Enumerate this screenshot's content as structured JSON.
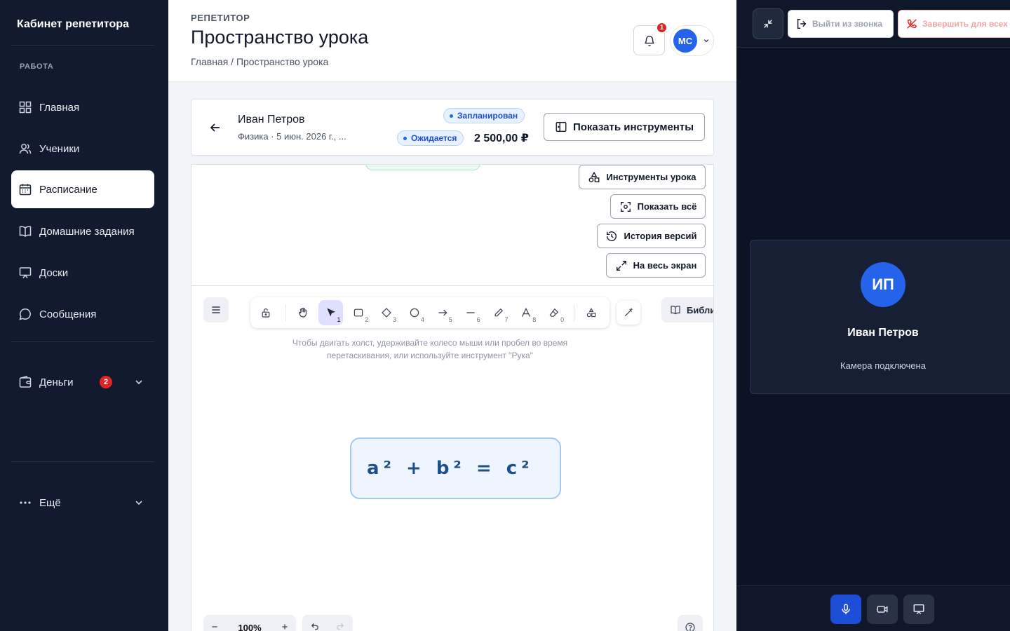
{
  "sidebar": {
    "brand": "Кабинет репетитора",
    "section": "РАБОТА",
    "items": [
      {
        "label": "Главная",
        "icon": "grid-icon"
      },
      {
        "label": "Ученики",
        "icon": "users-icon"
      },
      {
        "label": "Расписание",
        "icon": "calendar-icon",
        "active": true
      },
      {
        "label": "Домашние задания",
        "icon": "book-icon"
      },
      {
        "label": "Доски",
        "icon": "presentation-icon"
      },
      {
        "label": "Сообщения",
        "icon": "chat-icon"
      }
    ],
    "money": {
      "label": "Деньги",
      "badge": "2",
      "icon": "wallet-icon"
    },
    "more": {
      "label": "Ещё",
      "icon": "ellipsis-icon"
    }
  },
  "header": {
    "role": "РЕПЕТИТОР",
    "title": "Пространство урока",
    "breadcrumb": "Главная / Пространство урока",
    "notifications_badge": "1",
    "user_initials": "МС"
  },
  "lesson": {
    "student": "Иван Петров",
    "subtitle": "Физика · 5 июн. 2026 г., ...",
    "status_scheduled": "Запланирован",
    "status_pending": "Ожидается",
    "price": "2 500,00 ₽",
    "show_tools": "Показать инструменты"
  },
  "board_actions": {
    "lesson_tools": "Инструменты урока",
    "show_all": "Показать всё",
    "history": "История версий",
    "fullscreen": "На весь экран"
  },
  "canvas": {
    "tools": [
      {
        "icon": "lock-icon",
        "num": ""
      },
      {
        "icon": "hand-icon",
        "num": ""
      },
      {
        "icon": "pointer-icon",
        "num": "1",
        "active": true
      },
      {
        "icon": "rectangle-icon",
        "num": "2"
      },
      {
        "icon": "diamond-icon",
        "num": "3"
      },
      {
        "icon": "circle-icon",
        "num": "4"
      },
      {
        "icon": "arrow-icon",
        "num": "5"
      },
      {
        "icon": "line-icon",
        "num": "6"
      },
      {
        "icon": "pencil-icon",
        "num": "7"
      },
      {
        "icon": "text-icon",
        "num": "8"
      },
      {
        "icon": "eraser-icon",
        "num": "0"
      },
      {
        "icon": "shapes-icon",
        "num": ""
      }
    ],
    "library_label": "Библи",
    "hint": "Чтобы двигать холст, удерживайте колесо мыши или пробел во время перетаскивания, или используйте инструмент \"Рука\"",
    "formula": "a² + b² = c²",
    "zoom": "100%"
  },
  "call": {
    "leave": "Выйти из звонка",
    "end_all": "Завершить для всех",
    "participant_initials": "ИП",
    "participant_name": "Иван Петров",
    "participant_status": "Камера подключена",
    "colors": {
      "mic_active": "#1d4ed8",
      "panel": "#0c1323"
    }
  }
}
